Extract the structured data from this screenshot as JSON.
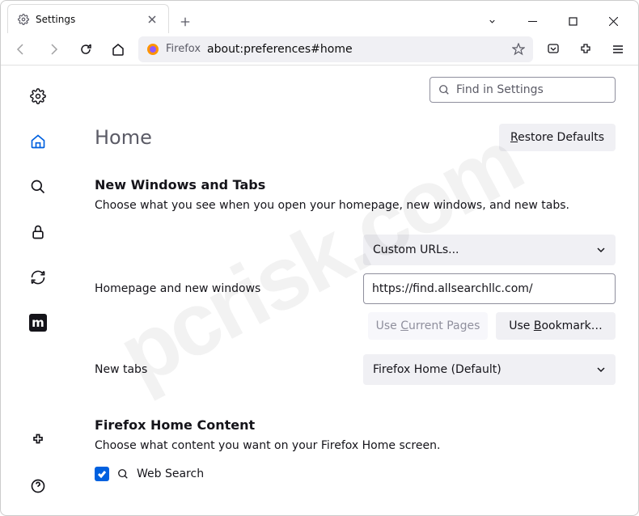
{
  "window": {
    "tab_title": "Settings",
    "newtab_tooltip": "New Tab"
  },
  "toolbar": {
    "url_proto": "Firefox",
    "url_addr": "about:preferences#home"
  },
  "search": {
    "placeholder": "Find in Settings"
  },
  "page": {
    "title": "Home",
    "restore_label": "Restore Defaults",
    "section1_title": "New Windows and Tabs",
    "section1_desc": "Choose what you see when you open your homepage, new windows, and new tabs.",
    "homepage_label": "Homepage and new windows",
    "homepage_mode": "Custom URLs...",
    "homepage_url": "https://find.allsearchllc.com/",
    "use_current_label": "Use Current Pages",
    "use_bookmark_label": "Use Bookmark…",
    "newtabs_label": "New tabs",
    "newtabs_mode": "Firefox Home (Default)",
    "section2_title": "Firefox Home Content",
    "section2_desc": "Choose what content you want on your Firefox Home screen.",
    "websearch_label": "Web Search"
  },
  "watermark": "pcrisk.com"
}
